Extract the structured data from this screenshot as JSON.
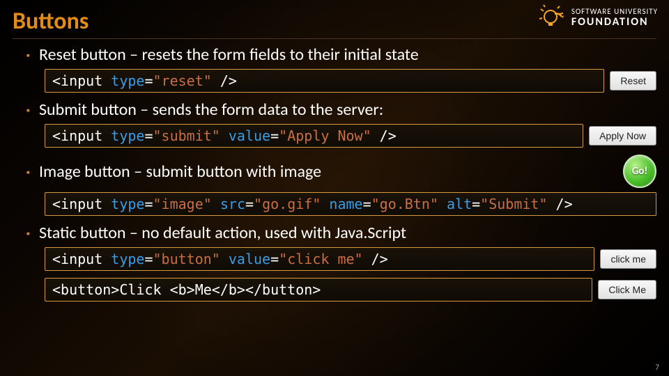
{
  "title": "Buttons",
  "logo": {
    "line1": "SOFTWARE UNIVERSITY",
    "line2": "FOUNDATION"
  },
  "items": [
    {
      "text": "Reset button – resets the form fields to their initial state",
      "code": {
        "pre": "<input ",
        "attr1": "type",
        "eq1": "=",
        "val1": "\"reset\"",
        "post": " />"
      },
      "button": {
        "variant": "gray",
        "label": "Reset"
      }
    },
    {
      "text": "Submit button – sends the form data to the server:",
      "code": {
        "pre": "<input ",
        "attr1": "type",
        "eq1": "=",
        "val1": "\"submit\"",
        "mid": " ",
        "attr2": "value",
        "eq2": "=",
        "val2": "\"Apply Now\"",
        "post": " />"
      },
      "button": {
        "variant": "gray",
        "label": "Apply Now"
      }
    },
    {
      "text": "Image button – submit button with image",
      "code": {
        "pre": "<input ",
        "attr1": "type",
        "eq1": "=",
        "val1": "\"image\"",
        "mid": " ",
        "attr2": "src",
        "eq2": "=",
        "val2": "\"go.gif\"",
        "mid2": " ",
        "attr3": "name",
        "eq3": "=",
        "val3": "\"go.Btn\"",
        "mid3": " ",
        "attr4": "alt",
        "eq4": "=",
        "val4": "\"Submit\"",
        "post": " />"
      },
      "button": {
        "variant": "go",
        "label": "Go!"
      },
      "full": true
    },
    {
      "text": "Static button – no default action, used with Java.Script",
      "code": {
        "pre": "<input ",
        "attr1": "type",
        "eq1": "=",
        "val1": "\"button\"",
        "mid": " ",
        "attr2": "value",
        "eq2": "=",
        "val2": "\"click me\"",
        "post": " />"
      },
      "button": {
        "variant": "gray",
        "label": "click me"
      },
      "extraCode": {
        "raw": "<button>Click <b>Me</b></button>"
      },
      "extraButton": {
        "variant": "gray",
        "label": "Click Me"
      }
    }
  ],
  "page": "7"
}
